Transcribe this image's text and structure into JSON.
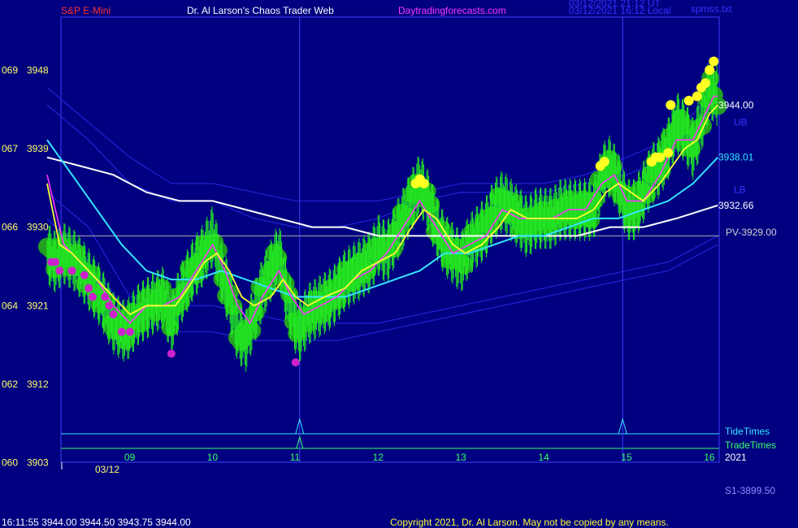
{
  "header": {
    "symbol": "S&P E-Mini",
    "title": "Dr. Al Larson's Chaos Trader Web",
    "site": "Daytradingforecasts.com",
    "stamp_ut": "03/12/2021 21:12 UT",
    "stamp_local": "03/12/2021 16:12 Local",
    "file": "spmss.txt"
  },
  "footer": {
    "quote": "16:11:55  3944.00 3944.50 3943.75 3944.00",
    "copyright": "Copyright 2021, Dr. Al Larson. May not be copied by any means."
  },
  "colors": {
    "background": "#000080",
    "frame": "#4040ff",
    "price": "#22ee22",
    "halo": "#22a022",
    "fast_avg": "#ffff33",
    "mid_avg": "#ff33ff",
    "slow_avg": "#33e6ff",
    "long_avg": "#ffffff",
    "bands": "#2020d0",
    "pivot": "#b0b0b0"
  },
  "chart_data": {
    "type": "line",
    "instrument": "S&P E-Mini",
    "date": "03/12",
    "year": "2021",
    "x_ticks": [
      "09",
      "10",
      "11",
      "12",
      "13",
      "14",
      "15",
      "16"
    ],
    "y_ticks": [
      {
        "left": "069",
        "price": 3948
      },
      {
        "left": "067",
        "price": 3939
      },
      {
        "left": "066",
        "price": 3930
      },
      {
        "left": "064",
        "price": 3921
      },
      {
        "left": "062",
        "price": 3912
      },
      {
        "left": "060",
        "price": 3903
      }
    ],
    "ylim": [
      3903,
      3953.5
    ],
    "xlim_hours": [
      8.0,
      16.15
    ],
    "price_series": {
      "name": "price",
      "points": [
        [
          8.0,
          3927
        ],
        [
          8.1,
          3926
        ],
        [
          8.2,
          3927
        ],
        [
          8.35,
          3926
        ],
        [
          8.5,
          3924
        ],
        [
          8.65,
          3922
        ],
        [
          8.8,
          3919
        ],
        [
          8.95,
          3918
        ],
        [
          9.1,
          3920
        ],
        [
          9.25,
          3921
        ],
        [
          9.4,
          3922
        ],
        [
          9.5,
          3919
        ],
        [
          9.6,
          3922
        ],
        [
          9.75,
          3925
        ],
        [
          9.9,
          3927
        ],
        [
          10.0,
          3929
        ],
        [
          10.1,
          3925
        ],
        [
          10.2,
          3922
        ],
        [
          10.3,
          3918
        ],
        [
          10.4,
          3917
        ],
        [
          10.5,
          3920
        ],
        [
          10.6,
          3923
        ],
        [
          10.7,
          3925
        ],
        [
          10.8,
          3927
        ],
        [
          10.9,
          3922
        ],
        [
          11.0,
          3919
        ],
        [
          11.05,
          3918
        ],
        [
          11.15,
          3920
        ],
        [
          11.3,
          3921
        ],
        [
          11.45,
          3922
        ],
        [
          11.6,
          3924
        ],
        [
          11.75,
          3925
        ],
        [
          11.9,
          3926
        ],
        [
          12.0,
          3928
        ],
        [
          12.1,
          3927
        ],
        [
          12.2,
          3929
        ],
        [
          12.3,
          3931
        ],
        [
          12.4,
          3933
        ],
        [
          12.5,
          3935
        ],
        [
          12.6,
          3933
        ],
        [
          12.7,
          3930
        ],
        [
          12.8,
          3928
        ],
        [
          12.9,
          3927
        ],
        [
          13.0,
          3926
        ],
        [
          13.1,
          3928
        ],
        [
          13.2,
          3929
        ],
        [
          13.3,
          3930
        ],
        [
          13.4,
          3932
        ],
        [
          13.5,
          3933
        ],
        [
          13.6,
          3932
        ],
        [
          13.7,
          3931
        ],
        [
          13.8,
          3930
        ],
        [
          13.9,
          3931
        ],
        [
          14.0,
          3931
        ],
        [
          14.1,
          3931
        ],
        [
          14.2,
          3932
        ],
        [
          14.3,
          3932
        ],
        [
          14.4,
          3932
        ],
        [
          14.5,
          3932
        ],
        [
          14.6,
          3932
        ],
        [
          14.7,
          3936
        ],
        [
          14.8,
          3937
        ],
        [
          14.9,
          3935
        ],
        [
          15.0,
          3932
        ],
        [
          15.1,
          3932
        ],
        [
          15.2,
          3934
        ],
        [
          15.3,
          3936
        ],
        [
          15.4,
          3937
        ],
        [
          15.5,
          3939
        ],
        [
          15.6,
          3942
        ],
        [
          15.7,
          3941
        ],
        [
          15.8,
          3939
        ],
        [
          15.9,
          3942
        ],
        [
          16.0,
          3946
        ],
        [
          16.1,
          3945
        ]
      ]
    },
    "fast_avg": {
      "name": "fast",
      "points": [
        [
          8.0,
          3935
        ],
        [
          8.15,
          3928
        ],
        [
          8.3,
          3927
        ],
        [
          8.5,
          3925
        ],
        [
          8.7,
          3923
        ],
        [
          8.9,
          3921
        ],
        [
          9.0,
          3920
        ],
        [
          9.2,
          3921
        ],
        [
          9.4,
          3921
        ],
        [
          9.55,
          3921
        ],
        [
          9.7,
          3923
        ],
        [
          9.9,
          3926
        ],
        [
          10.05,
          3927
        ],
        [
          10.2,
          3925
        ],
        [
          10.35,
          3922
        ],
        [
          10.5,
          3921
        ],
        [
          10.7,
          3922
        ],
        [
          10.85,
          3924
        ],
        [
          11.0,
          3922
        ],
        [
          11.15,
          3921
        ],
        [
          11.35,
          3922
        ],
        [
          11.6,
          3923
        ],
        [
          11.8,
          3925
        ],
        [
          12.0,
          3926
        ],
        [
          12.2,
          3927
        ],
        [
          12.4,
          3930
        ],
        [
          12.55,
          3932
        ],
        [
          12.7,
          3931
        ],
        [
          12.9,
          3928
        ],
        [
          13.05,
          3927
        ],
        [
          13.25,
          3928
        ],
        [
          13.45,
          3930
        ],
        [
          13.6,
          3932
        ],
        [
          13.8,
          3931
        ],
        [
          14.0,
          3931
        ],
        [
          14.2,
          3931
        ],
        [
          14.4,
          3931
        ],
        [
          14.6,
          3932
        ],
        [
          14.75,
          3934
        ],
        [
          14.9,
          3935
        ],
        [
          15.05,
          3934
        ],
        [
          15.2,
          3933
        ],
        [
          15.4,
          3935
        ],
        [
          15.55,
          3937
        ],
        [
          15.7,
          3939
        ],
        [
          15.85,
          3940
        ],
        [
          16.0,
          3943
        ],
        [
          16.1,
          3944
        ]
      ]
    },
    "mid_avg": {
      "name": "mid",
      "points": [
        [
          8.0,
          3936
        ],
        [
          8.2,
          3928
        ],
        [
          8.4,
          3926
        ],
        [
          8.6,
          3924
        ],
        [
          8.8,
          3921
        ],
        [
          9.0,
          3919
        ],
        [
          9.2,
          3921
        ],
        [
          9.4,
          3921
        ],
        [
          9.6,
          3922
        ],
        [
          9.8,
          3925
        ],
        [
          10.0,
          3928
        ],
        [
          10.15,
          3925
        ],
        [
          10.3,
          3921
        ],
        [
          10.45,
          3919
        ],
        [
          10.6,
          3922
        ],
        [
          10.8,
          3925
        ],
        [
          10.95,
          3922
        ],
        [
          11.1,
          3920
        ],
        [
          11.3,
          3921
        ],
        [
          11.5,
          3922
        ],
        [
          11.7,
          3924
        ],
        [
          11.9,
          3925
        ],
        [
          12.1,
          3927
        ],
        [
          12.3,
          3930
        ],
        [
          12.5,
          3933
        ],
        [
          12.7,
          3930
        ],
        [
          12.9,
          3927
        ],
        [
          13.1,
          3928
        ],
        [
          13.3,
          3929
        ],
        [
          13.5,
          3932
        ],
        [
          13.7,
          3931
        ],
        [
          13.9,
          3931
        ],
        [
          14.1,
          3931
        ],
        [
          14.3,
          3932
        ],
        [
          14.5,
          3932
        ],
        [
          14.7,
          3935
        ],
        [
          14.85,
          3936
        ],
        [
          15.0,
          3933
        ],
        [
          15.2,
          3933
        ],
        [
          15.4,
          3936
        ],
        [
          15.6,
          3940
        ],
        [
          15.8,
          3940
        ],
        [
          15.95,
          3943
        ],
        [
          16.05,
          3945
        ],
        [
          16.1,
          3945
        ]
      ]
    },
    "slow_avg": {
      "name": "slow",
      "points": [
        [
          8.0,
          3940
        ],
        [
          8.3,
          3936
        ],
        [
          8.6,
          3932
        ],
        [
          8.9,
          3928
        ],
        [
          9.2,
          3925
        ],
        [
          9.5,
          3924
        ],
        [
          9.8,
          3924
        ],
        [
          10.1,
          3925
        ],
        [
          10.4,
          3924
        ],
        [
          10.7,
          3923
        ],
        [
          11.0,
          3922
        ],
        [
          11.3,
          3922
        ],
        [
          11.6,
          3922
        ],
        [
          11.9,
          3923
        ],
        [
          12.2,
          3924
        ],
        [
          12.5,
          3925
        ],
        [
          12.8,
          3927
        ],
        [
          13.1,
          3927
        ],
        [
          13.4,
          3928
        ],
        [
          13.7,
          3929
        ],
        [
          14.0,
          3929
        ],
        [
          14.3,
          3930
        ],
        [
          14.6,
          3931
        ],
        [
          14.9,
          3931
        ],
        [
          15.2,
          3932
        ],
        [
          15.5,
          3933
        ],
        [
          15.8,
          3935
        ],
        [
          16.1,
          3938
        ]
      ]
    },
    "long_avg": {
      "name": "long",
      "points": [
        [
          8.0,
          3938
        ],
        [
          8.4,
          3937
        ],
        [
          8.8,
          3936
        ],
        [
          9.2,
          3934
        ],
        [
          9.6,
          3933
        ],
        [
          10.0,
          3933
        ],
        [
          10.4,
          3932
        ],
        [
          10.8,
          3931
        ],
        [
          11.2,
          3930
        ],
        [
          11.6,
          3930
        ],
        [
          12.0,
          3929
        ],
        [
          12.4,
          3929
        ],
        [
          12.8,
          3929
        ],
        [
          13.2,
          3929
        ],
        [
          13.6,
          3929
        ],
        [
          14.0,
          3929
        ],
        [
          14.4,
          3929
        ],
        [
          14.8,
          3930
        ],
        [
          15.2,
          3930
        ],
        [
          15.6,
          3931
        ],
        [
          16.1,
          3932.5
        ]
      ]
    },
    "upper_band": {
      "name": "upper",
      "points": [
        [
          8.0,
          3944
        ],
        [
          8.5,
          3940
        ],
        [
          9.0,
          3935
        ],
        [
          9.5,
          3933
        ],
        [
          10.0,
          3933
        ],
        [
          10.5,
          3931
        ],
        [
          11.0,
          3930
        ],
        [
          11.5,
          3930
        ],
        [
          12.0,
          3931
        ],
        [
          12.5,
          3933
        ],
        [
          13.0,
          3934
        ],
        [
          13.5,
          3934
        ],
        [
          14.0,
          3934
        ],
        [
          14.5,
          3935
        ],
        [
          15.0,
          3936
        ],
        [
          15.5,
          3938
        ],
        [
          16.1,
          3943
        ]
      ]
    },
    "upper_band2": {
      "name": "upper2",
      "points": [
        [
          8.0,
          3946
        ],
        [
          8.5,
          3942
        ],
        [
          9.0,
          3938
        ],
        [
          9.5,
          3935
        ],
        [
          10.0,
          3935
        ],
        [
          10.5,
          3934
        ],
        [
          11.0,
          3933
        ],
        [
          11.5,
          3933
        ],
        [
          12.0,
          3933
        ],
        [
          12.5,
          3934
        ],
        [
          13.0,
          3935
        ],
        [
          13.5,
          3935
        ],
        [
          14.0,
          3935
        ],
        [
          14.5,
          3936
        ],
        [
          15.0,
          3938
        ],
        [
          15.5,
          3940
        ],
        [
          16.1,
          3946
        ]
      ]
    },
    "lower_band": {
      "name": "lower",
      "points": [
        [
          8.0,
          3934
        ],
        [
          8.5,
          3930
        ],
        [
          9.0,
          3922
        ],
        [
          9.5,
          3921
        ],
        [
          10.0,
          3921
        ],
        [
          10.5,
          3920
        ],
        [
          11.0,
          3919
        ],
        [
          11.5,
          3919
        ],
        [
          12.0,
          3919
        ],
        [
          12.5,
          3920
        ],
        [
          13.0,
          3921
        ],
        [
          13.5,
          3922
        ],
        [
          14.0,
          3923
        ],
        [
          14.5,
          3924
        ],
        [
          15.0,
          3925
        ],
        [
          15.5,
          3926
        ],
        [
          16.1,
          3929
        ]
      ]
    },
    "lower_band2": {
      "name": "lower2",
      "points": [
        [
          8.0,
          3931
        ],
        [
          8.5,
          3926
        ],
        [
          9.0,
          3920
        ],
        [
          9.5,
          3918
        ],
        [
          10.0,
          3918
        ],
        [
          10.5,
          3917
        ],
        [
          11.0,
          3917
        ],
        [
          11.5,
          3917
        ],
        [
          12.0,
          3918
        ],
        [
          12.5,
          3919
        ],
        [
          13.0,
          3920
        ],
        [
          13.5,
          3921
        ],
        [
          14.0,
          3922
        ],
        [
          14.5,
          3923
        ],
        [
          15.0,
          3924
        ],
        [
          15.5,
          3925
        ],
        [
          16.1,
          3928
        ]
      ]
    },
    "magenta_dots": [
      [
        8.05,
        3926
      ],
      [
        8.1,
        3926
      ],
      [
        8.15,
        3925
      ],
      [
        8.3,
        3925
      ],
      [
        8.45,
        3924.5
      ],
      [
        8.5,
        3923
      ],
      [
        8.55,
        3922
      ],
      [
        8.7,
        3922
      ],
      [
        8.75,
        3921
      ],
      [
        8.8,
        3920
      ],
      [
        8.9,
        3918
      ],
      [
        9.0,
        3918
      ],
      [
        9.5,
        3915.5
      ],
      [
        11.0,
        3914.5
      ]
    ],
    "yellow_dots": [
      [
        12.45,
        3935
      ],
      [
        12.5,
        3935.5
      ],
      [
        12.55,
        3935
      ],
      [
        14.68,
        3937
      ],
      [
        14.73,
        3937.5
      ],
      [
        15.3,
        3937.5
      ],
      [
        15.35,
        3938
      ],
      [
        15.4,
        3938
      ],
      [
        15.5,
        3938.5
      ],
      [
        15.53,
        3944
      ],
      [
        15.75,
        3944.5
      ],
      [
        15.85,
        3945
      ],
      [
        15.9,
        3946
      ],
      [
        15.95,
        3946.5
      ],
      [
        16.0,
        3948
      ],
      [
        16.05,
        3949
      ]
    ],
    "pivot": {
      "label": "PV-3929.00",
      "price": 3929
    },
    "right_labels": [
      {
        "text": "3944.00",
        "price": 3944,
        "color": "#ffffff"
      },
      {
        "text": "UB",
        "price": 3942,
        "color": "#3333ff"
      },
      {
        "text": "3938.01",
        "price": 3938,
        "color": "#33e6ff"
      },
      {
        "text": "LB",
        "price": 3934.3,
        "color": "#3333ff"
      },
      {
        "text": "3932.66",
        "price": 3932.5,
        "color": "#ffffff"
      }
    ],
    "tide_label": "TideTimes",
    "trade_label": "TradeTimes",
    "markers_hours": [
      11.05,
      14.95
    ],
    "s1_label": "S1-3899.50"
  }
}
